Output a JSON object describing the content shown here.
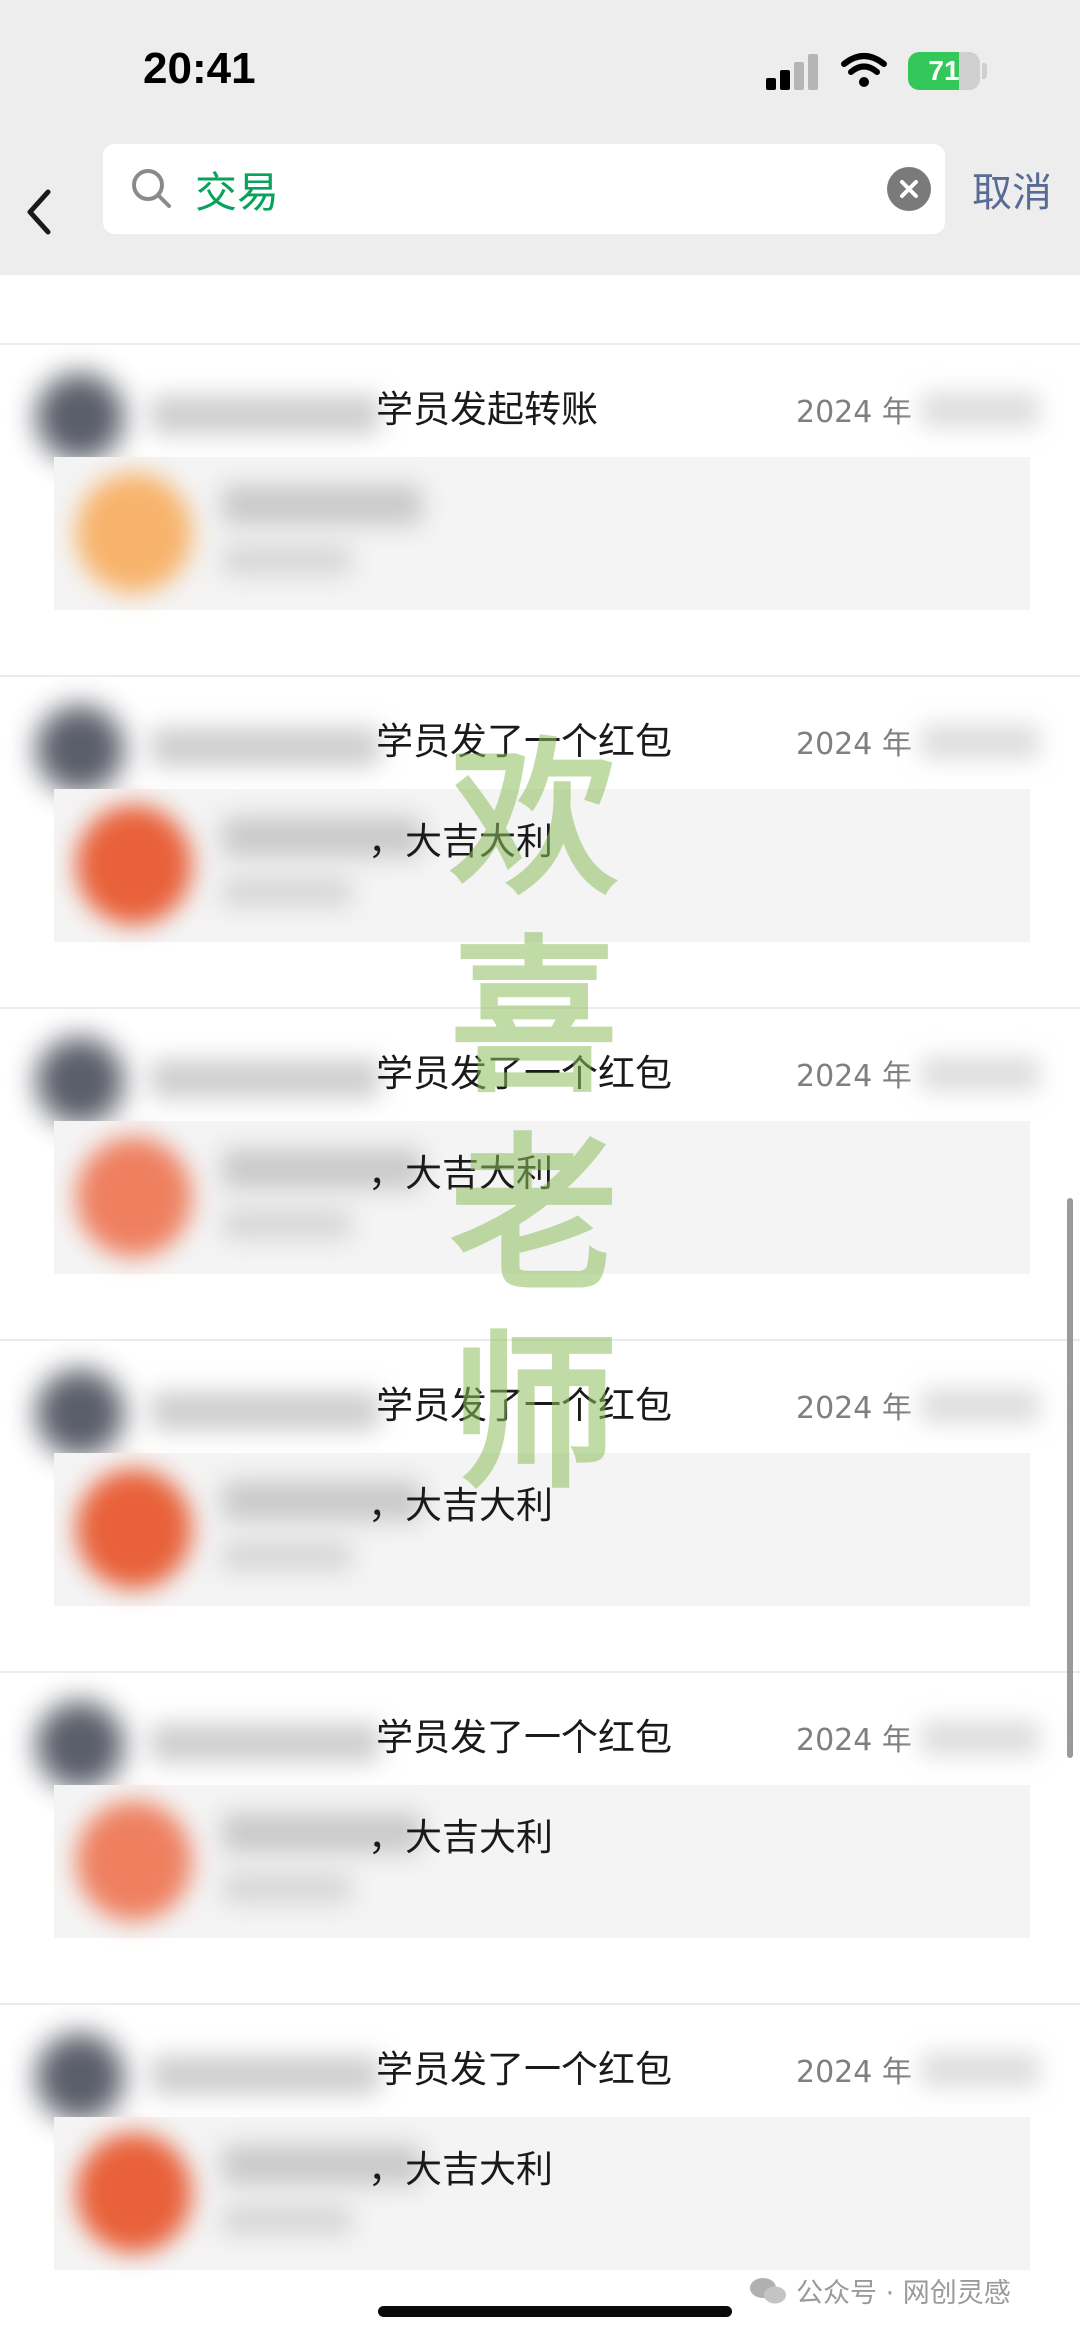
{
  "status_bar": {
    "time": "20:41",
    "battery_percent": 71,
    "battery_label": "71"
  },
  "search": {
    "query": "交易",
    "cancel_label": "取消"
  },
  "results": [
    {
      "message": "学员发起转账",
      "date": "2024 年",
      "card_text": ""
    },
    {
      "message": "学员发了一个红包",
      "date": "2024 年",
      "card_text": "，大吉大利"
    },
    {
      "message": "学员发了一个红包",
      "date": "2024 年",
      "card_text": "，大吉大利"
    },
    {
      "message": "学员发了一个红包",
      "date": "2024 年",
      "card_text": "，大吉大利"
    },
    {
      "message": "学员发了一个红包",
      "date": "2024 年",
      "card_text": "，大吉大利"
    },
    {
      "message": "学员发了一个红包",
      "date": "2024 年",
      "card_text": "，大吉大利"
    }
  ],
  "watermark": {
    "chars": [
      "欢",
      "喜",
      "老",
      "师"
    ]
  },
  "footer": {
    "label": "公众号 · 网创灵感"
  },
  "colors": {
    "search_text": "#07a35a",
    "cancel": "#576b95",
    "battery": "#34c759",
    "watermark": "#8fbf5f"
  }
}
